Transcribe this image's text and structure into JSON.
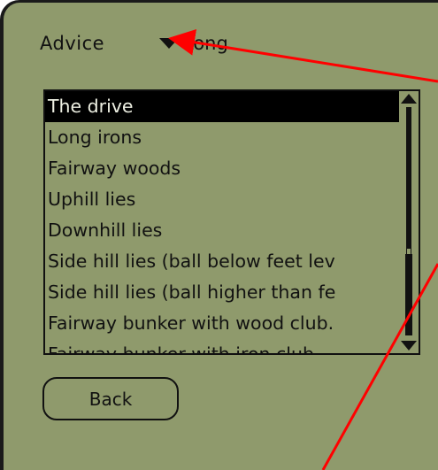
{
  "header": {
    "title": "Advice"
  },
  "category_dropdown": {
    "value": "Long",
    "icon": "triangle-down-icon"
  },
  "advice_list": {
    "items": [
      "The drive",
      "Long irons",
      "Fairway woods",
      "Uphill lies",
      "Downhill lies",
      "Side hill lies (ball below feet lev",
      "Side hill lies (ball higher than fe",
      "Fairway bunker with wood club.",
      "Fairway bunker with iron club."
    ],
    "selected_index": 0
  },
  "footer": {
    "back_label": "Back"
  },
  "colors": {
    "screen": "#8f9a6c",
    "ink": "#111111",
    "annotation": "#ff0000"
  }
}
